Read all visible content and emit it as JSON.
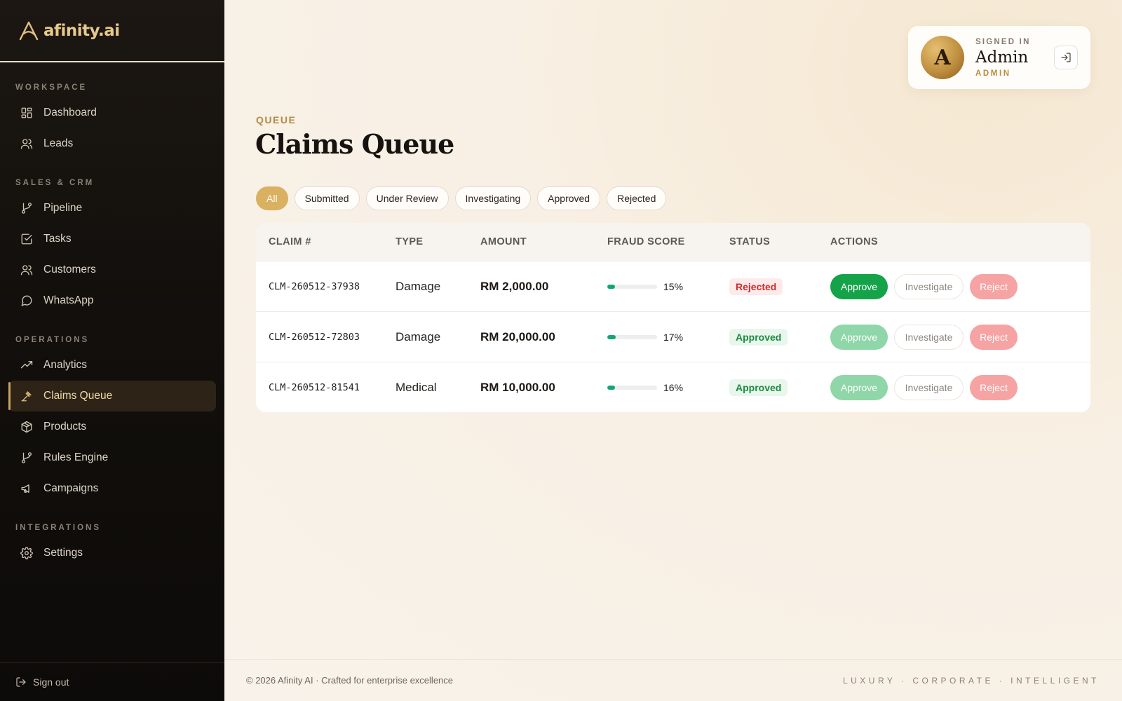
{
  "brand": {
    "name": "afinity.ai"
  },
  "sidebar": {
    "groups": [
      {
        "label": "WORKSPACE",
        "items": [
          {
            "label": "Dashboard",
            "icon": "grid-icon"
          },
          {
            "label": "Leads",
            "icon": "users-icon"
          }
        ]
      },
      {
        "label": "SALES & CRM",
        "items": [
          {
            "label": "Pipeline",
            "icon": "git-branch-icon"
          },
          {
            "label": "Tasks",
            "icon": "check-square-icon"
          },
          {
            "label": "Customers",
            "icon": "users-icon"
          },
          {
            "label": "WhatsApp",
            "icon": "chat-bubble-icon"
          }
        ]
      },
      {
        "label": "OPERATIONS",
        "items": [
          {
            "label": "Analytics",
            "icon": "trend-up-icon"
          },
          {
            "label": "Claims Queue",
            "icon": "gavel-icon",
            "active": true
          },
          {
            "label": "Products",
            "icon": "box-icon"
          },
          {
            "label": "Rules Engine",
            "icon": "git-branch-icon"
          },
          {
            "label": "Campaigns",
            "icon": "megaphone-icon"
          }
        ]
      },
      {
        "label": "INTEGRATIONS",
        "items": [
          {
            "label": "Settings",
            "icon": "gear-icon"
          }
        ]
      }
    ],
    "signout": "Sign out"
  },
  "user": {
    "signed_in_label": "SIGNED IN",
    "initial": "A",
    "name": "Admin",
    "role": "ADMIN"
  },
  "page": {
    "eyebrow": "QUEUE",
    "title": "Claims Queue"
  },
  "filters": [
    "All",
    "Submitted",
    "Under Review",
    "Investigating",
    "Approved",
    "Rejected"
  ],
  "active_filter": "All",
  "table": {
    "headers": [
      "CLAIM #",
      "TYPE",
      "AMOUNT",
      "FRAUD SCORE",
      "STATUS",
      "ACTIONS"
    ],
    "rows": [
      {
        "claim": "CLM-260512-37938",
        "type": "Damage",
        "amount": "RM 2,000.00",
        "fraud_pct": "15%",
        "fraud_value": 0.15,
        "status": "Rejected",
        "status_kind": "rejected",
        "approve_enabled": true
      },
      {
        "claim": "CLM-260512-72803",
        "type": "Damage",
        "amount": "RM 20,000.00",
        "fraud_pct": "17%",
        "fraud_value": 0.17,
        "status": "Approved",
        "status_kind": "approved",
        "approve_enabled": false
      },
      {
        "claim": "CLM-260512-81541",
        "type": "Medical",
        "amount": "RM 10,000.00",
        "fraud_pct": "16%",
        "fraud_value": 0.16,
        "status": "Approved",
        "status_kind": "approved",
        "approve_enabled": false
      }
    ],
    "actions": {
      "approve": "Approve",
      "investigate": "Investigate",
      "reject": "Reject"
    }
  },
  "footer": {
    "left": "© 2026 Afinity AI · Crafted for enterprise excellence",
    "right": "LUXURY · CORPORATE · INTELLIGENT"
  },
  "colors": {
    "accent": "#d9b160",
    "sidebar_bg": "#120f0c",
    "approve": "#15a34a",
    "reject": "#f5a3a3"
  }
}
